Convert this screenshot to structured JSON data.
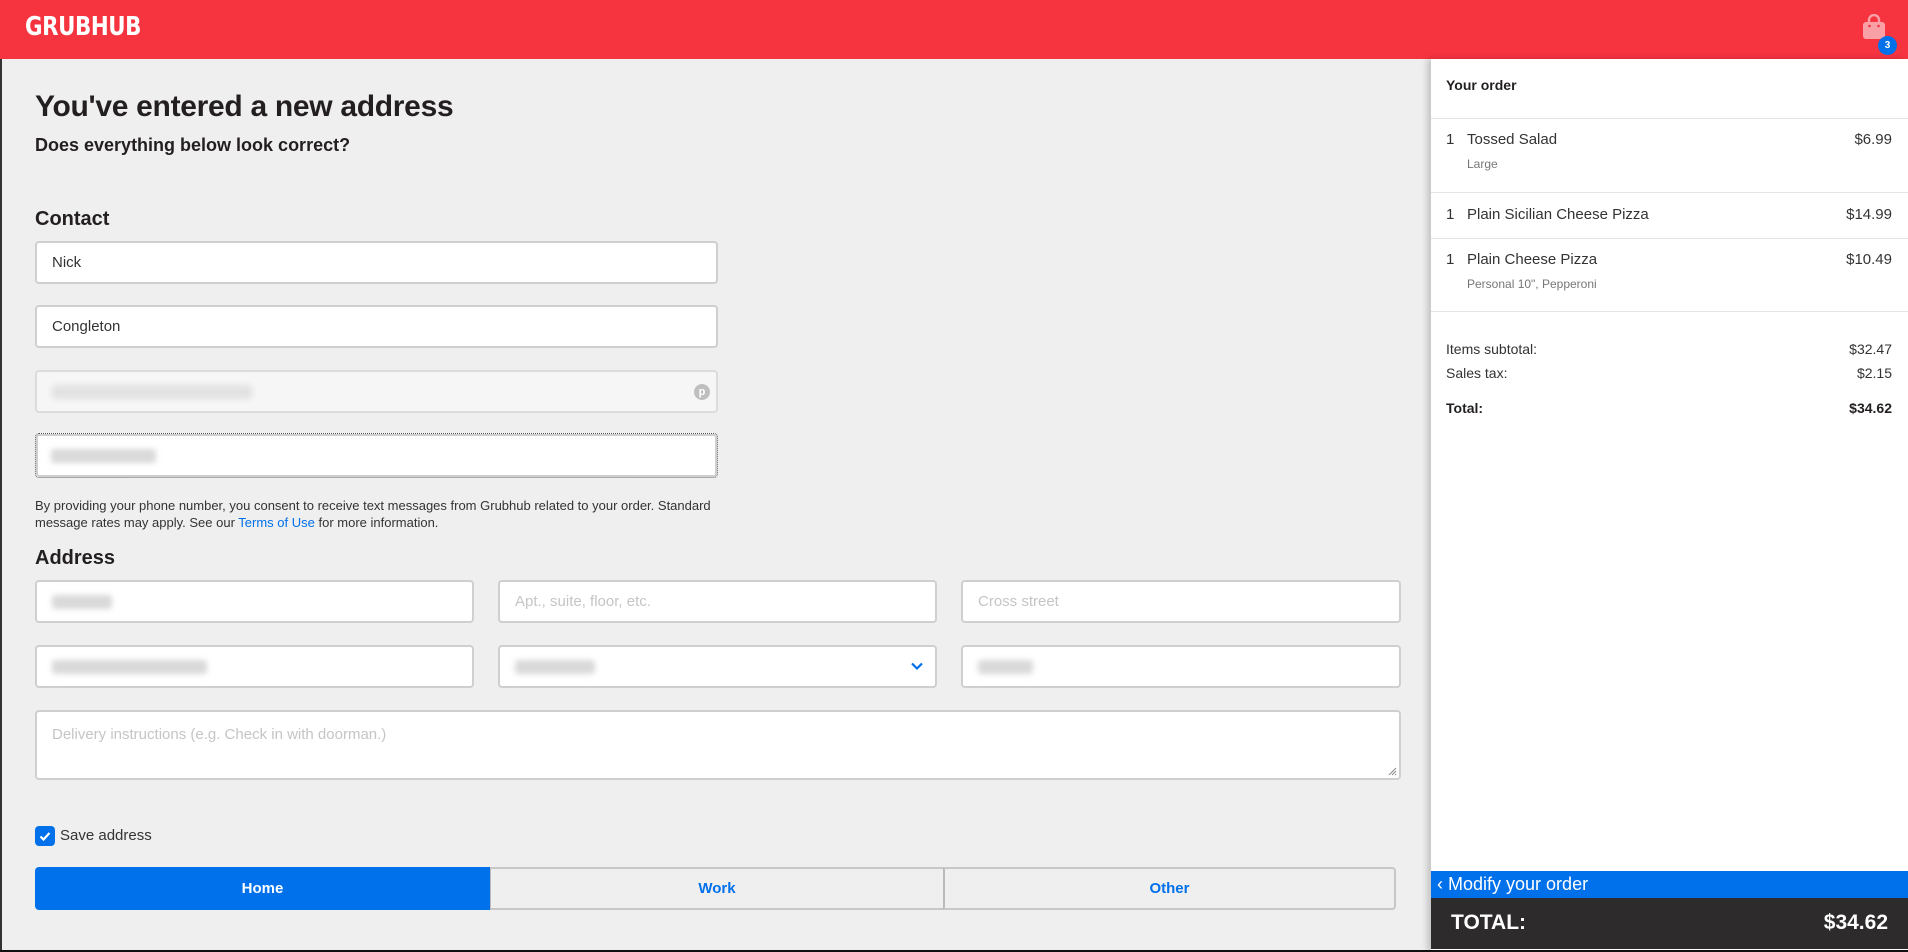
{
  "header": {
    "logo": "GRUBHUB",
    "cart_icon": "shopping-bag-icon",
    "cart_count": "3",
    "brand_color": "#f63440",
    "accent_color": "#0070eb"
  },
  "page": {
    "title": "You've entered a new address",
    "subtitle": "Does everything below look correct?"
  },
  "contact": {
    "heading": "Contact",
    "first_name": "Nick",
    "last_name": "Congleton",
    "email_icon": "p-autofill-icon",
    "consent_text_before": "By providing your phone number, you consent to receive text messages from Grubhub related to your order. Standard message rates may apply. See our ",
    "consent_link": "Terms of Use",
    "consent_text_after": " for more information."
  },
  "address": {
    "heading": "Address",
    "apt_placeholder": "Apt., suite, floor, etc.",
    "cross_street_placeholder": "Cross street",
    "instructions_placeholder": "Delivery instructions (e.g. Check in with doorman.)",
    "save_address_label": "Save address",
    "save_address_checked": true,
    "address_types": [
      {
        "label": "Home",
        "selected": true
      },
      {
        "label": "Work",
        "selected": false
      },
      {
        "label": "Other",
        "selected": false
      }
    ]
  },
  "order": {
    "title": "Your order",
    "items": [
      {
        "qty": "1",
        "name": "Tossed Salad",
        "options": "Large",
        "price": "$6.99"
      },
      {
        "qty": "1",
        "name": "Plain Sicilian Cheese Pizza",
        "options": "",
        "price": "$14.99"
      },
      {
        "qty": "1",
        "name": "Plain Cheese Pizza",
        "options": "Personal 10\", Pepperoni",
        "price": "$10.49"
      }
    ],
    "subtotal_label": "Items subtotal:",
    "subtotal": "$32.47",
    "tax_label": "Sales tax:",
    "tax": "$2.15",
    "total_label": "Total:",
    "total": "$34.62",
    "modify_label": "Modify your order",
    "footer_total_label": "TOTAL:",
    "footer_total": "$34.62"
  }
}
